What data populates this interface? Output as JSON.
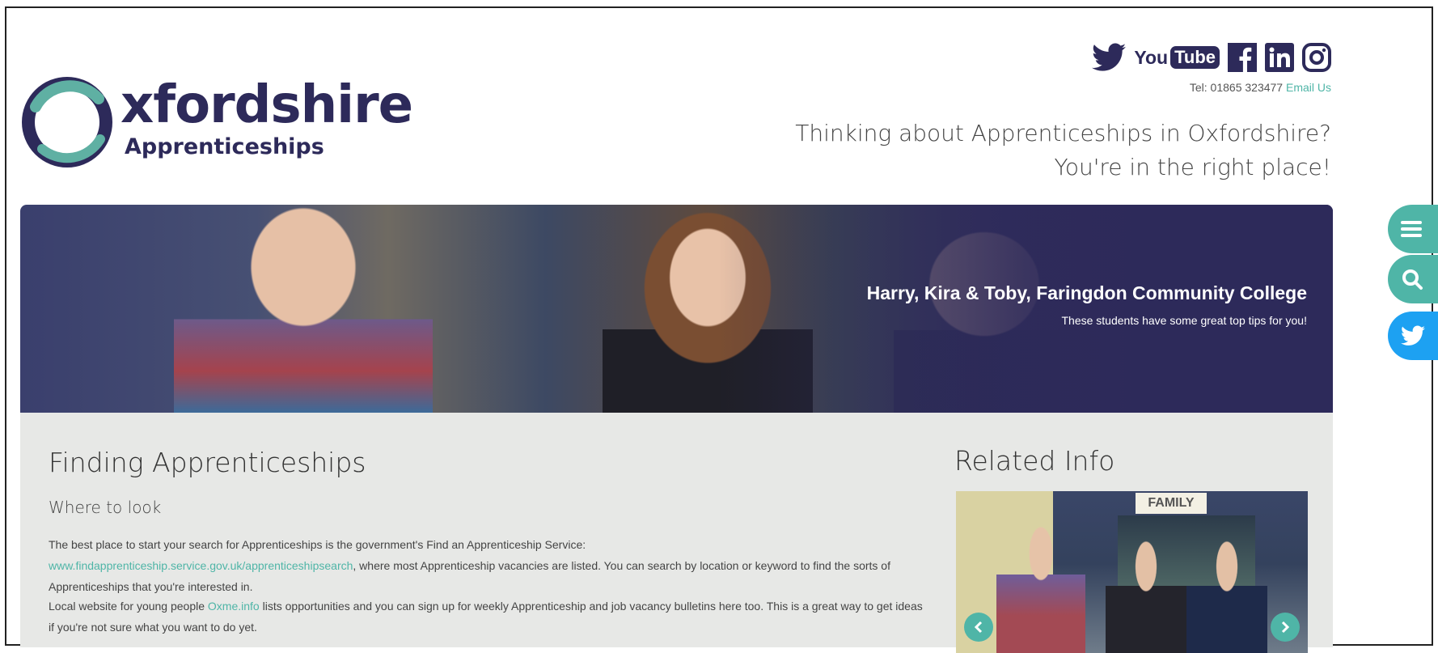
{
  "header": {
    "logo": {
      "word1": "xfordshire",
      "word2": "Apprenticeships"
    },
    "social": {
      "youtube_left": "You",
      "youtube_right": "Tube"
    },
    "contact": {
      "tel": "Tel: 01865 323477",
      "email_label": "Email Us"
    },
    "tagline_line1": "Thinking about Apprenticeships in Oxfordshire?",
    "tagline_line2": "You're in the right place!"
  },
  "hero": {
    "title": "Harry, Kira & Toby, Faringdon Community College",
    "subtitle": "These students have some great top tips for you!"
  },
  "content": {
    "title": "Finding Apprenticeships",
    "subtitle": "Where to look",
    "para1_start": "The best place to start your search for Apprenticeships is the government's Find an Apprenticeship Service:",
    "para1_link": "www.findapprenticeship.service.gov.uk/apprenticeshipsearch",
    "para1_end": ", where most Apprenticeship vacancies are listed. You can search by location or keyword to find the sorts of Apprenticeships that you're interested in.",
    "para2_start": "Local website for young people ",
    "para2_link": "Oxme.info",
    "para2_end": " lists opportunities and you can sign up for weekly Apprenticeship and job vacancy bulletins here too. This is a great way to get ideas if you're not sure what you want to do yet."
  },
  "related": {
    "title": "Related Info",
    "image_sign": "FAMILY"
  },
  "colors": {
    "brand_navy": "#2d2a5a",
    "accent_teal": "#4fb5a7",
    "twitter_blue": "#1da1f2"
  }
}
